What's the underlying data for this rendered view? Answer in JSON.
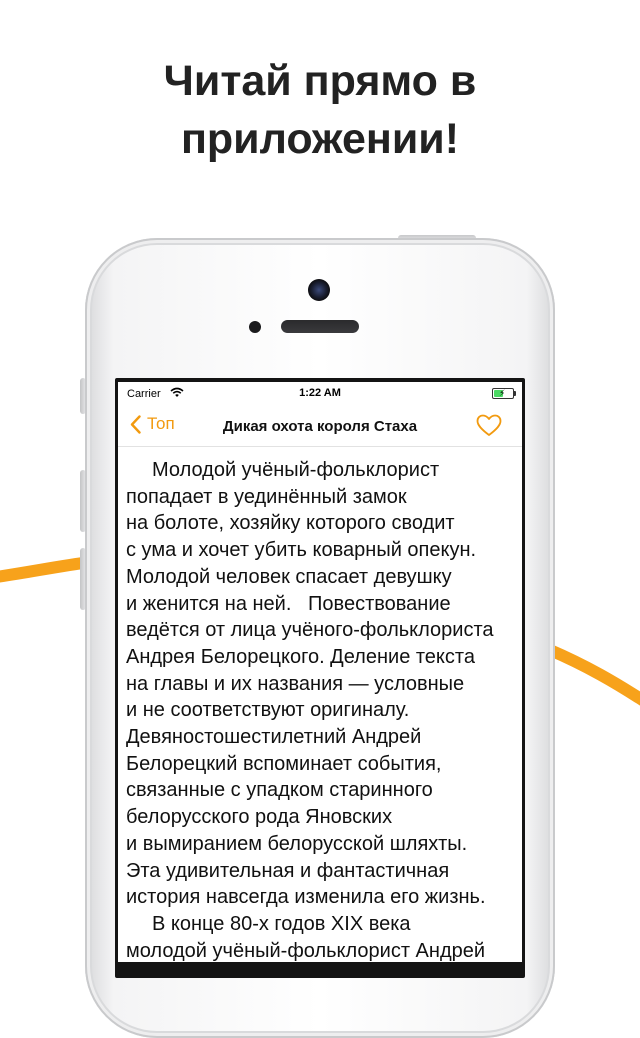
{
  "headline": {
    "line1": "Читай прямо в",
    "line2": "приложении!"
  },
  "colors": {
    "accent": "#f29a0f",
    "decor_curve": "#f7a21b"
  },
  "status_bar": {
    "carrier": "Carrier",
    "wifi_icon": "wifi-icon",
    "time": "1:22 AM",
    "battery_icon": "battery-charging-icon",
    "battery_level": 0.5
  },
  "nav_bar": {
    "back_icon": "chevron-left-icon",
    "back_label": "Топ",
    "title": "Дикая охота короля Стаха",
    "favorite_icon": "heart-outline-icon"
  },
  "reader": {
    "lines": [
      "Молодой учёный-фольклорист",
      "попадает в уединённый замок",
      "на болоте, хозяйку которого сводит",
      "с ума и хочет убить коварный опекун.",
      "Молодой человек спасает девушку",
      "и женится на ней.   Повествование",
      "ведётся от лица учёного-фольклориста",
      "Андрея Белорецкого. Деление текста",
      "на главы и их названия — условные",
      "и не соответствуют оригиналу.",
      "Девяностошестилетний Андрей",
      "Белорецкий вспоминает события,",
      "связанные с упадком старинного",
      "белорусского рода Яновских",
      "и вымиранием белорусской шляхты.",
      "Эта удивительная и фантастичная",
      "история навсегда изменила его жизнь.",
      "В конце 80-х годов XIX века",
      "молодой учёный-фольклорист Андрей"
    ]
  }
}
